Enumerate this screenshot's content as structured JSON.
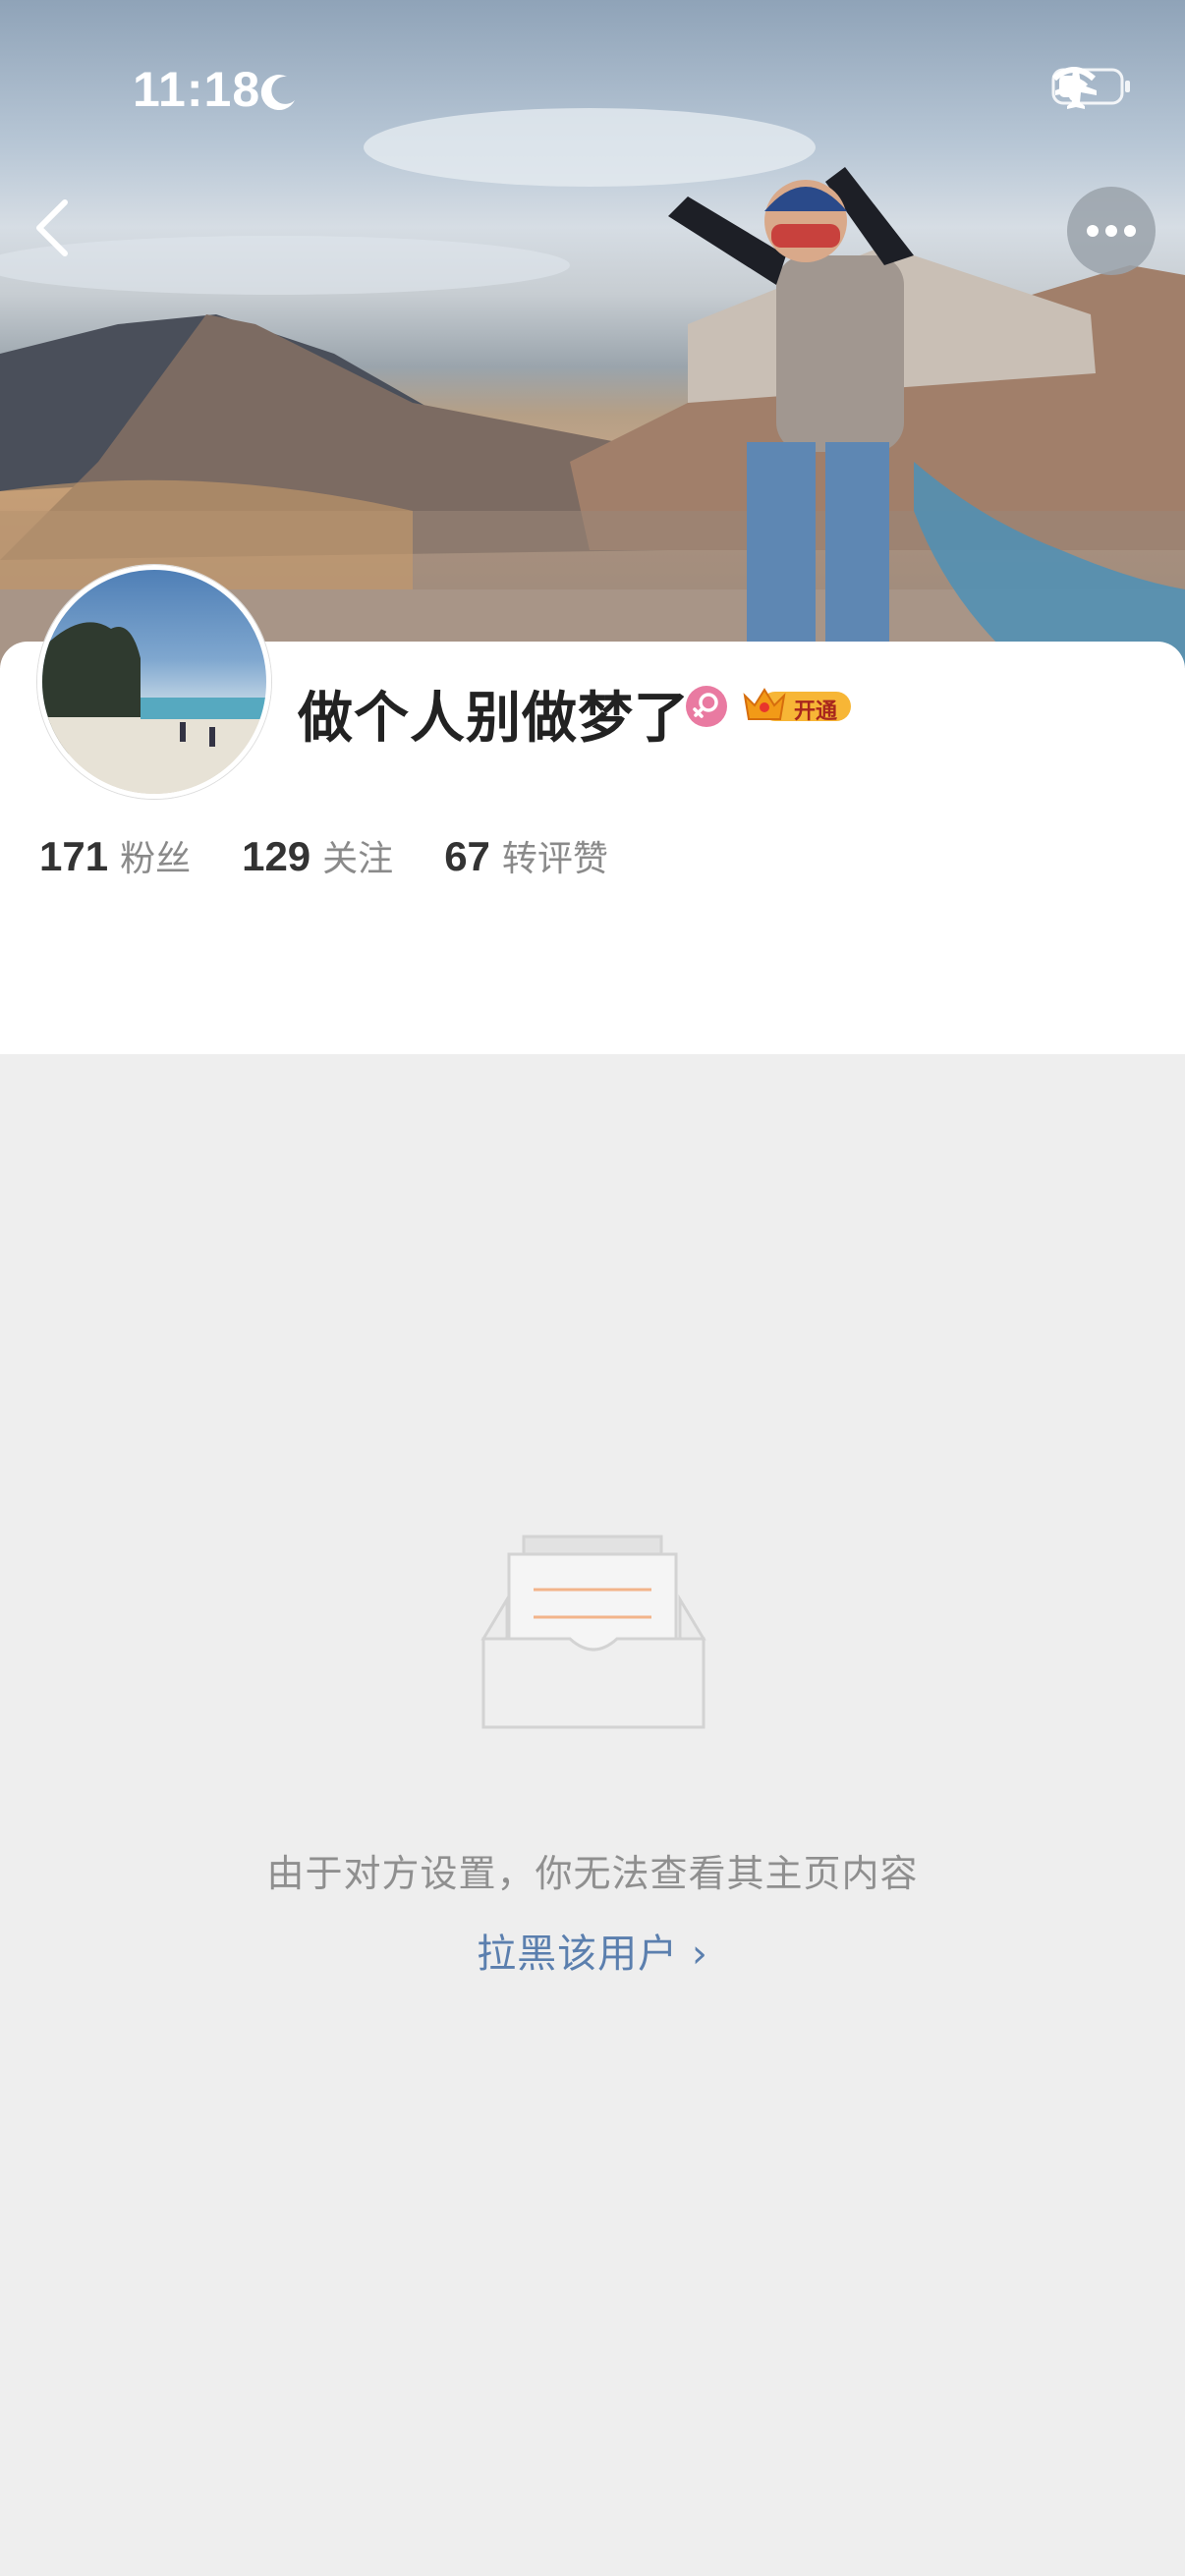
{
  "status_bar": {
    "time": "11:18"
  },
  "profile": {
    "username": "做个人别做梦了",
    "vip_badge_text": "开通",
    "stats": [
      {
        "value": "171",
        "label": "粉丝"
      },
      {
        "value": "129",
        "label": "关注"
      },
      {
        "value": "67",
        "label": "转评赞"
      }
    ]
  },
  "empty_state": {
    "message": "由于对方设置，你无法查看其主页内容",
    "block_link": "拉黑该用户 ›"
  },
  "colors": {
    "link": "#5b7fae",
    "gender_badge": "#e97aa1",
    "vip_badge": "#f7b636"
  }
}
